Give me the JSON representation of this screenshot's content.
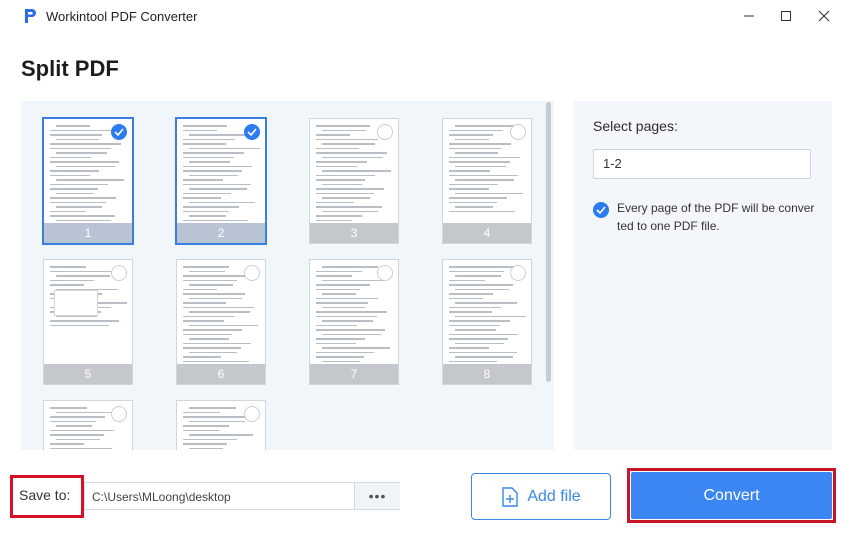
{
  "window": {
    "title": "Workintool PDF Converter",
    "logo_icon": "p-logo-icon"
  },
  "page": {
    "title": "Split PDF"
  },
  "thumbnails": [
    {
      "label": "1",
      "selected": true
    },
    {
      "label": "2",
      "selected": true
    },
    {
      "label": "3",
      "selected": false
    },
    {
      "label": "4",
      "selected": false
    },
    {
      "label": "5",
      "selected": false
    },
    {
      "label": "6",
      "selected": false
    },
    {
      "label": "7",
      "selected": false
    },
    {
      "label": "8",
      "selected": false
    },
    {
      "label": "",
      "selected": false
    },
    {
      "label": "",
      "selected": false
    }
  ],
  "options": {
    "select_pages_label": "Select pages:",
    "pages_value": "1-2",
    "every_page_text": "Every page of the PDF will be converted to one PDF file.",
    "every_page_checked": true
  },
  "footer": {
    "save_to_label": "Save to:",
    "path": "C:\\Users\\MLoong\\desktop",
    "browse_label": "•••",
    "add_file_label": "Add file",
    "convert_label": "Convert"
  },
  "colors": {
    "accent": "#3b86f2",
    "highlight": "#d3112b"
  }
}
